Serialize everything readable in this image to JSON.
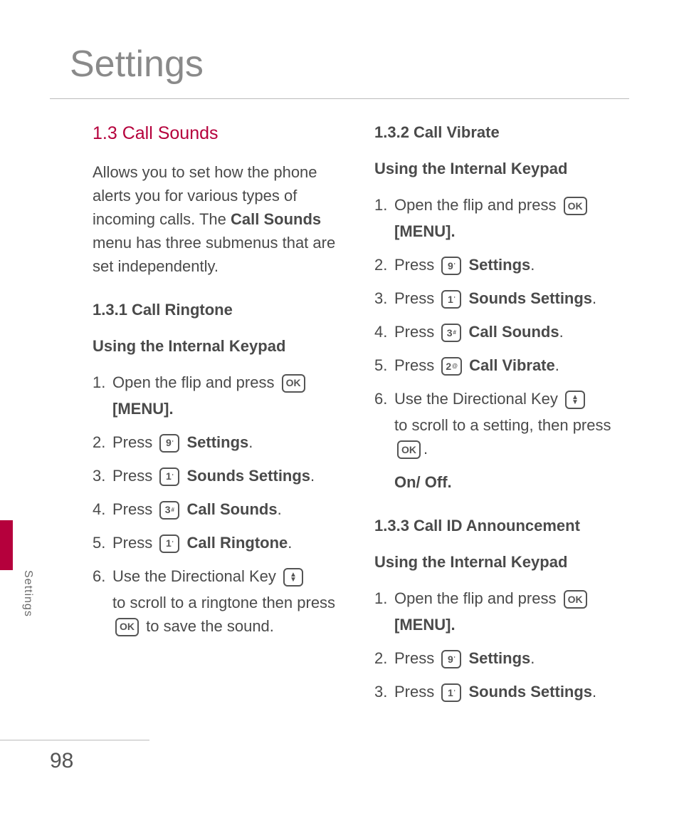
{
  "page_title": "Settings",
  "side_label": "Settings",
  "page_number": "98",
  "left": {
    "section_heading": "1.3 Call Sounds",
    "intro_pre": "Allows you to set how the phone alerts you for various types of incoming calls. The ",
    "intro_bold": "Call Sounds",
    "intro_post": " menu has three submenus that are set independently.",
    "sub_heading": "1.3.1 Call Ringtone",
    "method_heading": "Using the Internal Keypad",
    "steps": {
      "s1_a": "Open the flip and press ",
      "s1_menu": "[MENU]",
      "s2_a": "Press ",
      "s2_b": "Settings",
      "s3_a": "Press ",
      "s3_b": "Sounds Settings",
      "s4_a": "Press ",
      "s4_b": "Call Sounds",
      "s5_a": "Press ",
      "s5_b": "Call Ringtone",
      "s6_a": "Use the Directional Key ",
      "s6_b": "to scroll to a ringtone then press ",
      "s6_c": " to save the sound."
    }
  },
  "right": {
    "sub_heading": "1.3.2 Call Vibrate",
    "method_heading": "Using the Internal Keypad",
    "steps": {
      "s1_a": "Open the flip and press ",
      "s1_menu": "[MENU]",
      "s2_a": "Press ",
      "s2_b": "Settings",
      "s3_a": "Press ",
      "s3_b": "Sounds Settings",
      "s4_a": "Press ",
      "s4_b": "Call Sounds",
      "s5_a": "Press ",
      "s5_b": "Call Vibrate",
      "s6_a": "Use the Directional Key ",
      "s6_b": "to scroll to a setting, then press ",
      "s6_onoff": "On/ Off"
    },
    "sub_heading2": "1.3.3 Call ID Announcement",
    "method_heading2": "Using the Internal Keypad",
    "steps2": {
      "s1_a": "Open the flip and press ",
      "s1_menu": "[MENU]",
      "s2_a": "Press ",
      "s2_b": "Settings",
      "s3_a": "Press ",
      "s3_b": "Sounds Settings"
    }
  },
  "keys": {
    "ok": "OK",
    "k9": "9",
    "k9s": "'",
    "k1": "1",
    "k1s": "'",
    "k3": "3",
    "k3s": "#",
    "k2": "2",
    "k2s": "@",
    "up": "▲",
    "down": "▼"
  },
  "punct": {
    "period": ".",
    "space": " "
  }
}
